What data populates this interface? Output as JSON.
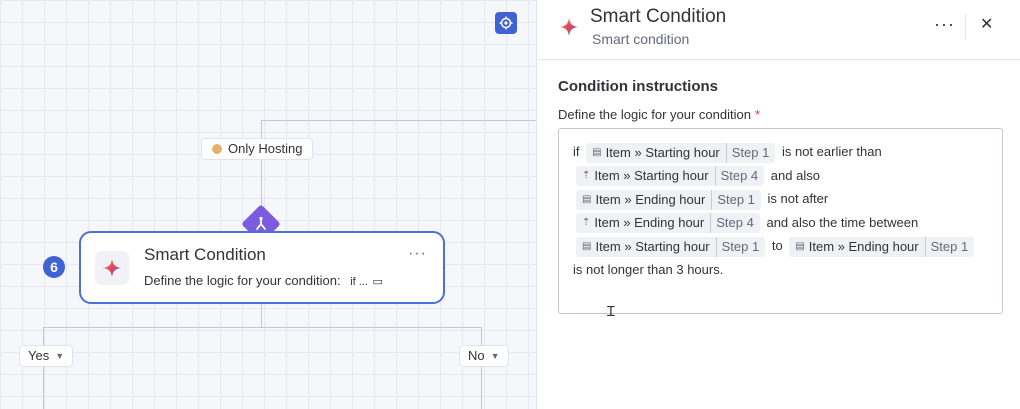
{
  "canvas": {
    "filter_tag": "Only Hosting",
    "node": {
      "number": "6",
      "title": "Smart Condition",
      "description": "Define the logic for your condition:",
      "truncated_preview": "if ...",
      "more_icon": "more-dots-icon"
    },
    "branches": {
      "yes_label": "Yes",
      "no_label": "No"
    }
  },
  "panel": {
    "title": "Smart Condition",
    "subtitle": "Smart condition",
    "section_title": "Condition instructions",
    "field_label": "Define the logic for your condition",
    "required_mark": "*",
    "logic": {
      "if": "if",
      "chip1": {
        "text": "Item » Starting hour",
        "step": "Step 1"
      },
      "t1": "is not earlier than",
      "chip2": {
        "text": "Item » Starting hour",
        "step": "Step 4"
      },
      "t2": "and also",
      "chip3": {
        "text": "Item » Ending hour",
        "step": "Step 1"
      },
      "t3": "is not after",
      "chip4": {
        "text": "Item » Ending hour",
        "step": "Step 4"
      },
      "t4": "and also the time between",
      "chip5": {
        "text": "Item » Starting hour",
        "step": "Step 1"
      },
      "t5": "to",
      "chip6": {
        "text": "Item » Ending hour",
        "step": "Step 1"
      },
      "t6": "is not longer than 3 hours."
    }
  },
  "colors": {
    "accent": "#3f62d4",
    "node_border": "#4d6fd8",
    "diamond": "#7b5ce0",
    "required": "#d83a52"
  }
}
